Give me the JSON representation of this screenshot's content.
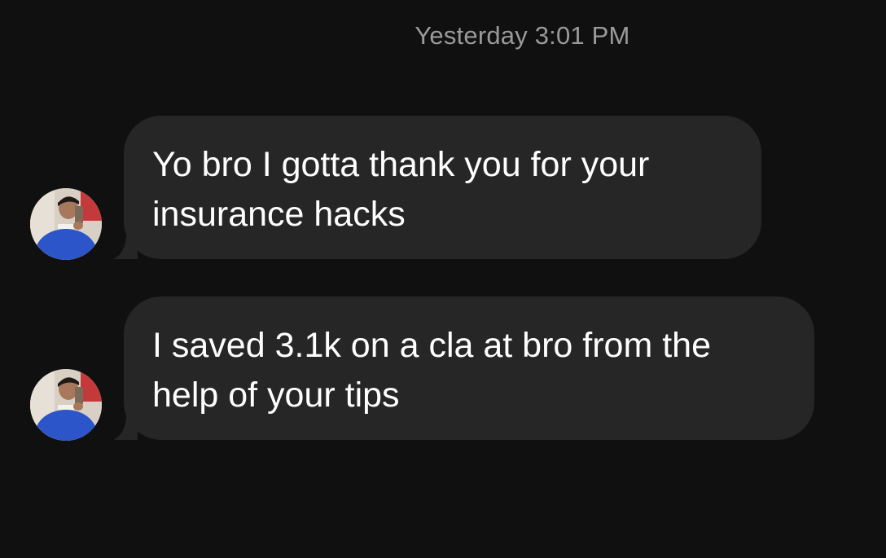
{
  "conversation": {
    "timestamp": "Yesterday 3:01 PM",
    "messages": [
      {
        "text": "Yo bro I gotta thank you for your\ninsurance hacks",
        "avatar_icon": "user-avatar-icon"
      },
      {
        "text": "I saved 3.1k on a cla at bro from the\nhelp of your tips",
        "avatar_icon": "user-avatar-icon"
      }
    ]
  },
  "colors": {
    "background": "#101010",
    "bubble": "#262626",
    "timestamp": "#9a9a9a",
    "message_text": "#ffffff"
  }
}
